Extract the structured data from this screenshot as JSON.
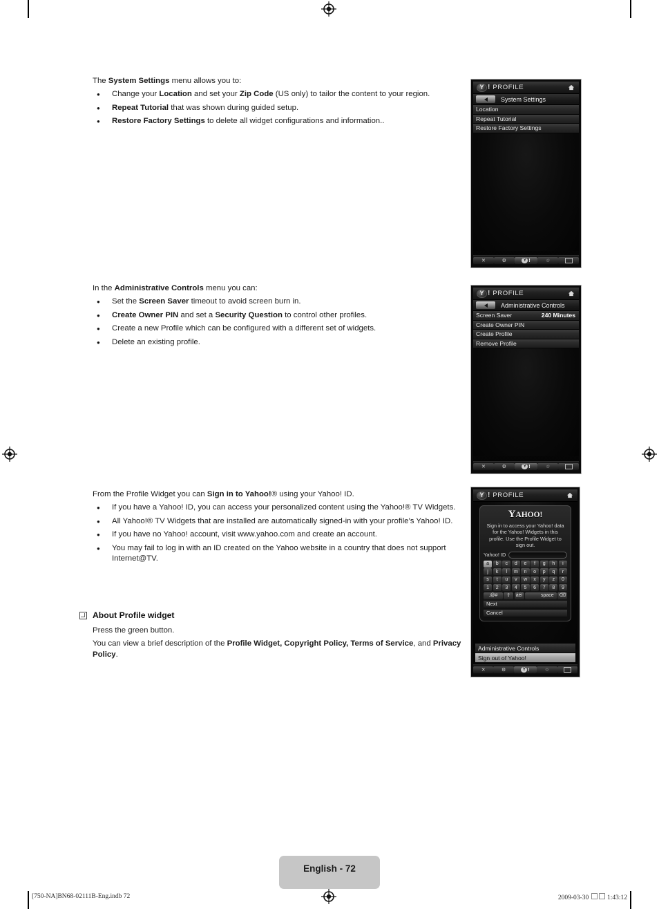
{
  "document": {
    "page_badge": "English - 72",
    "footer_left": "[750-NA]BN68-02111B-Eng.indb   72",
    "footer_date": "2009-03-30",
    "footer_time": "1:43:12"
  },
  "section_system_settings": {
    "intro_pre": "The ",
    "intro_bold": "System Settings",
    "intro_post": " menu allows you to:",
    "bullets": [
      {
        "parts": [
          {
            "t": "Change your ",
            "b": false
          },
          {
            "t": "Location",
            "b": true
          },
          {
            "t": " and set your ",
            "b": false
          },
          {
            "t": "Zip Code",
            "b": true
          },
          {
            "t": " (US only) to tailor the content to your region.",
            "b": false
          }
        ]
      },
      {
        "parts": [
          {
            "t": "Repeat Tutorial",
            "b": true
          },
          {
            "t": " that was shown during guided setup.",
            "b": false
          }
        ]
      },
      {
        "parts": [
          {
            "t": "Restore Factory Settings",
            "b": true
          },
          {
            "t": " to delete all widget configurations and information..",
            "b": false
          }
        ]
      }
    ]
  },
  "section_admin_controls": {
    "intro_pre": "In the ",
    "intro_bold": "Administrative Controls",
    "intro_post": " menu you can:",
    "bullets": [
      {
        "parts": [
          {
            "t": "Set the ",
            "b": false
          },
          {
            "t": "Screen Saver",
            "b": true
          },
          {
            "t": " timeout to avoid screen burn in.",
            "b": false
          }
        ]
      },
      {
        "parts": [
          {
            "t": "Create Owner PIN",
            "b": true
          },
          {
            "t": " and set a ",
            "b": false
          },
          {
            "t": "Security Question",
            "b": true
          },
          {
            "t": " to control other profiles.",
            "b": false
          }
        ]
      },
      {
        "parts": [
          {
            "t": "Create a new Profile which can be configured with a different set of widgets.",
            "b": false
          }
        ]
      },
      {
        "parts": [
          {
            "t": "Delete an existing profile.",
            "b": false
          }
        ]
      }
    ]
  },
  "section_signin": {
    "intro_pre": "From the Profile Widget you can ",
    "intro_bold": "Sign in to Yahoo!",
    "intro_post": "® using your Yahoo! ID.",
    "bullets": [
      {
        "parts": [
          {
            "t": "If you have a Yahoo! ID, you can access your personalized content using the Yahoo!® TV Widgets.",
            "b": false
          }
        ]
      },
      {
        "parts": [
          {
            "t": "All Yahoo!® TV Widgets that are installed are automatically signed-in with your profile’s Yahoo! ID.",
            "b": false
          }
        ]
      },
      {
        "parts": [
          {
            "t": "If you have no Yahoo! account, visit www.yahoo.com and create an account.",
            "b": false
          }
        ]
      },
      {
        "parts": [
          {
            "t": "You may fail to log in with an ID created on the Yahoo website in a country that does not support Internet@TV.",
            "b": false
          }
        ]
      }
    ]
  },
  "section_about": {
    "heading": "About Profile widget",
    "line1": "Press the green button.",
    "line2_parts": [
      {
        "t": "You can view a brief description of the ",
        "b": false
      },
      {
        "t": "Profile Widget, Copyright Policy, Terms of Service",
        "b": true
      },
      {
        "t": ", and ",
        "b": false
      },
      {
        "t": "Privacy Policy",
        "b": true
      },
      {
        "t": ".",
        "b": false
      }
    ]
  },
  "tv_panel_1": {
    "title": "PROFILE",
    "y_letter": "Y",
    "bang": "!",
    "subbar": "System Settings",
    "rows": [
      {
        "label": "Location",
        "value": ""
      },
      {
        "label": "Repeat Tutorial",
        "value": ""
      },
      {
        "label": "Restore Factory Settings",
        "value": ""
      }
    ]
  },
  "tv_panel_2": {
    "title": "PROFILE",
    "y_letter": "Y",
    "bang": "!",
    "subbar": "Administrative Controls",
    "rows": [
      {
        "label": "Screen Saver",
        "value": "240 Minutes"
      },
      {
        "label": "Create Owner PIN",
        "value": ""
      },
      {
        "label": "Create Profile",
        "value": ""
      },
      {
        "label": "Remove Profile",
        "value": ""
      }
    ]
  },
  "tv_panel_3": {
    "title": "PROFILE",
    "y_letter": "Y",
    "bang": "!",
    "logo_big": "Y",
    "logo_rest": "AHOO!",
    "blurb": "Sign in to access your Yahoo! data for the Yahoo! Widgets in this profile. Use the Profile Widget to sign out.",
    "id_label": "Yahoo! ID",
    "id_value": "",
    "keyboard": [
      [
        "a",
        "b",
        "c",
        "d",
        "e",
        "f",
        "g",
        "h",
        "i"
      ],
      [
        "j",
        "k",
        "l",
        "m",
        "n",
        "o",
        "p",
        "q",
        "r"
      ],
      [
        "s",
        "t",
        "u",
        "v",
        "w",
        "x",
        "y",
        "z",
        "0"
      ],
      [
        "1",
        "2",
        "3",
        "4",
        "5",
        "6",
        "7",
        "8",
        "9"
      ]
    ],
    "keyboard_selected": "a",
    "keyboard_bottom": {
      "symbols": ".@#",
      "shift": "⇧",
      "accents": "áéí",
      "space": "space",
      "backspace": "⌫"
    },
    "actions": [
      "Next",
      "Cancel"
    ],
    "below_rows": [
      {
        "label": "Administrative Controls",
        "highlight": false
      },
      {
        "label": "Sign out of Yahoo!",
        "highlight": true
      }
    ]
  },
  "toolbar": {
    "close": "✕",
    "gear": "⚙",
    "yahoo_y": "Y",
    "yahoo_bang": "!",
    "star": "☆",
    "grid": "grid"
  }
}
